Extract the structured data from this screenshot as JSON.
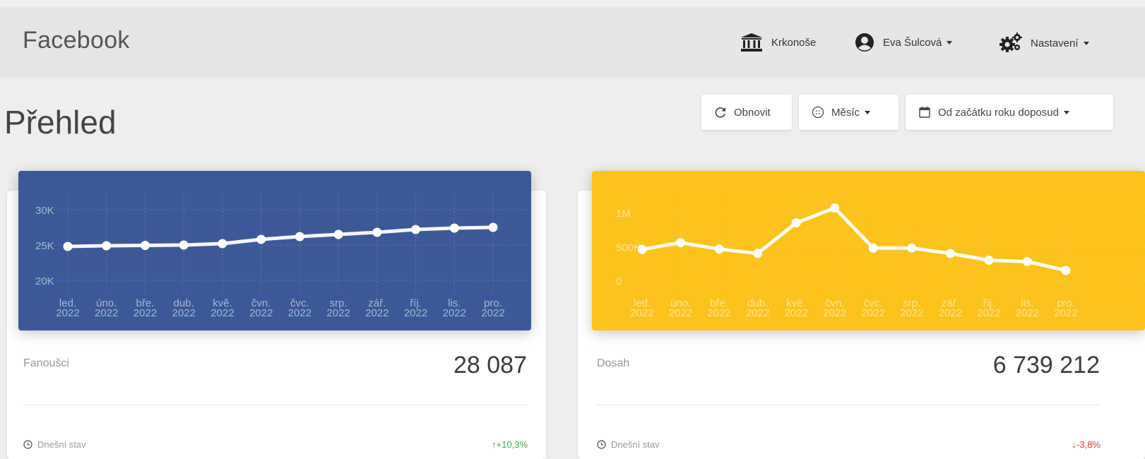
{
  "navbar": {
    "brand": "Facebook",
    "items": [
      {
        "label": "Krkonoše",
        "icon": "institution-icon"
      },
      {
        "label": "Eva Šulcová",
        "icon": "user-circle-icon"
      },
      {
        "label": "Nastavení",
        "icon": "gears-icon"
      }
    ]
  },
  "page": {
    "title": "Přehled"
  },
  "toolbar": {
    "refresh_label": "Obnovit",
    "period_label": "Měsíc",
    "range_label": "Od začátku roku doposud"
  },
  "cards": [
    {
      "label": "Fanoušci",
      "value": "28 087",
      "footer": "Dnešní stav",
      "change": "+10,3%",
      "change_direction": "up",
      "color": "#3b5998"
    },
    {
      "label": "Dosah",
      "value": "6 739 212",
      "footer": "Dnešní stav",
      "change": "-3,8%",
      "change_direction": "down",
      "color": "#fbc31b"
    }
  ],
  "chart_data": [
    {
      "type": "line",
      "categories": [
        [
          "led.",
          "2022"
        ],
        [
          "úno.",
          "2022"
        ],
        [
          "bře.",
          "2022"
        ],
        [
          "dub.",
          "2022"
        ],
        [
          "kvě.",
          "2022"
        ],
        [
          "čvn.",
          "2022"
        ],
        [
          "čvc.",
          "2022"
        ],
        [
          "srp.",
          "2022"
        ],
        [
          "zář.",
          "2022"
        ],
        [
          "říj.",
          "2022"
        ],
        [
          "lis.",
          "2022"
        ],
        [
          "pro.",
          "2022"
        ]
      ],
      "values": [
        24800,
        24900,
        24950,
        25000,
        25200,
        25800,
        26200,
        26500,
        26800,
        27200,
        27400,
        27500
      ],
      "yticks": [
        {
          "v": 30000,
          "label": "30K"
        },
        {
          "v": 25000,
          "label": "25K"
        },
        {
          "v": 20000,
          "label": "20K"
        }
      ],
      "ylim": [
        19000,
        31500
      ],
      "background": "#3b5998"
    },
    {
      "type": "line",
      "categories": [
        [
          "led.",
          "2022"
        ],
        [
          "úno.",
          "2022"
        ],
        [
          "bře.",
          "2022"
        ],
        [
          "dub.",
          "2022"
        ],
        [
          "kvě.",
          "2022"
        ],
        [
          "čvn.",
          "2022"
        ],
        [
          "čvc.",
          "2022"
        ],
        [
          "srp.",
          "2022"
        ],
        [
          "zář.",
          "2022"
        ],
        [
          "říj.",
          "2022"
        ],
        [
          "lis.",
          "2022"
        ],
        [
          "pro.",
          "2022"
        ]
      ],
      "values": [
        460000,
        560000,
        465000,
        400000,
        850000,
        1070000,
        480000,
        480000,
        400000,
        300000,
        280000,
        150000
      ],
      "yticks": [
        {
          "v": 1000000,
          "label": "1M"
        },
        {
          "v": 500000,
          "label": "500K"
        },
        {
          "v": 0,
          "label": "0"
        }
      ],
      "ylim": [
        -100000,
        1200000
      ],
      "background": "#fbc31b"
    }
  ]
}
